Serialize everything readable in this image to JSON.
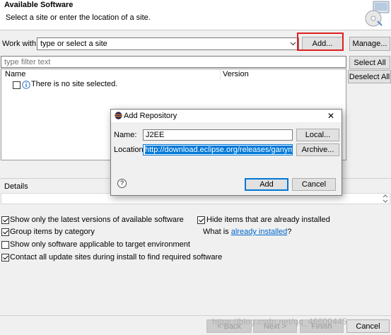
{
  "header": {
    "title": "Available Software",
    "subtitle": "Select a site or enter the location of a site."
  },
  "work_with": {
    "label": "Work with:",
    "value": "type or select a site",
    "add_label": "Add...",
    "manage_label": "Manage..."
  },
  "filter": {
    "placeholder": "type filter text"
  },
  "side_buttons": {
    "select_all": "Select All",
    "deselect_all": "Deselect All"
  },
  "table": {
    "columns": [
      "Name",
      "Version"
    ],
    "empty_message": "There is no site selected."
  },
  "details": {
    "label": "Details"
  },
  "options": {
    "show_latest": {
      "label": "Show only the latest versions of available software",
      "checked": true
    },
    "group_by_category": {
      "label": "Group items by category",
      "checked": true
    },
    "applicable_only": {
      "label": "Show only software applicable to target environment",
      "checked": false
    },
    "contact_all_sites": {
      "label": "Contact all update sites during install to find required software",
      "checked": true
    },
    "hide_installed": {
      "label": "Hide items that are already installed",
      "checked": true
    },
    "what_is_prefix": "What is",
    "already_installed_link": "already installed",
    "what_is_suffix": "?"
  },
  "footer": {
    "back_label": "< Back",
    "next_label": "Next >",
    "finish_label": "Finish",
    "cancel_label": "Cancel",
    "watermark": "https://blog.csdn.net/qq_46600445"
  },
  "add_repository_dialog": {
    "title": "Add Repository",
    "name_label": "Name:",
    "name_value": "J2EE",
    "location_label": "Location:",
    "location_value": "http://download.eclipse.org/releases/ganymede",
    "local_label": "Local...",
    "archive_label": "Archive...",
    "add_label": "Add",
    "cancel_label": "Cancel",
    "close_glyph": "✕",
    "help_glyph": "?"
  },
  "colors": {
    "highlight_box": "#e02020",
    "link": "#0066cc",
    "selection": "#0078d7",
    "default_button_border": "#0078d7"
  }
}
